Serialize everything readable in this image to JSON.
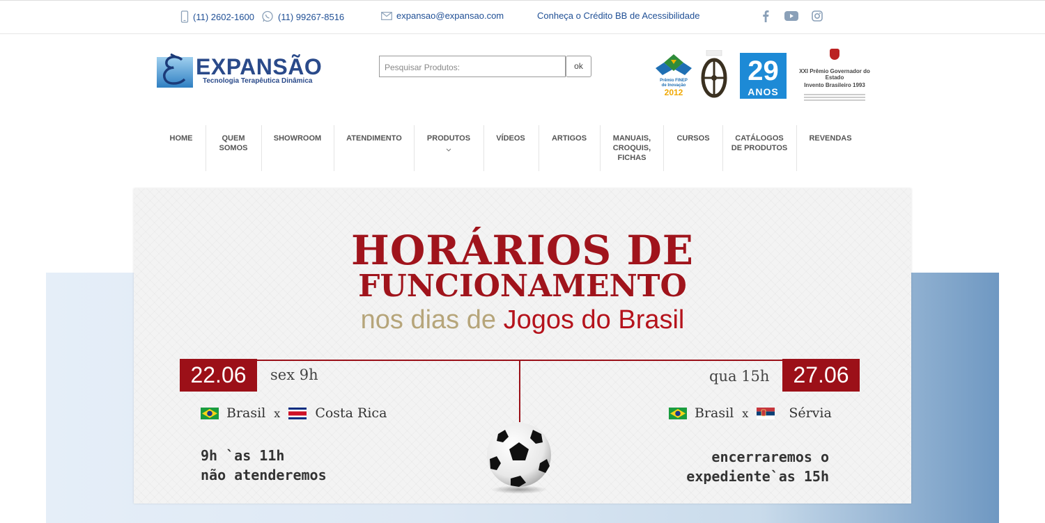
{
  "topbar": {
    "phone": "(11) 2602-1600",
    "whatsapp": "(11) 99267-8516",
    "email": "expansao@expansao.com",
    "accessibility_link": "Conheça o Crédito BB de Acessibilidade",
    "icons": [
      "phone-icon",
      "whatsapp-icon",
      "mail-icon",
      "facebook-icon",
      "youtube-icon",
      "instagram-icon"
    ]
  },
  "header": {
    "brand": "EXPANSÃO",
    "tagline": "Tecnologia Terapêutica Dinâmica",
    "search_placeholder": "Pesquisar Produtos:",
    "search_button": "ok",
    "awards": {
      "finep_line1": "Prêmio FINEP",
      "finep_line2": "de Inovação",
      "finep_year": "2012",
      "years_number": "29",
      "years_label": "ANOS",
      "gov_line1": "XXI Prêmio Governador do Estado",
      "gov_line2": "Invento Brasileiro 1993"
    }
  },
  "nav": {
    "items": [
      {
        "label": "HOME"
      },
      {
        "label": "QUEM\nSOMOS"
      },
      {
        "label": "SHOWROOM"
      },
      {
        "label": "ATENDIMENTO"
      },
      {
        "label": "PRODUTOS",
        "dropdown": true
      },
      {
        "label": "VÍDEOS"
      },
      {
        "label": "ARTIGOS"
      },
      {
        "label": "MANUAIS,\nCROQUIS,\nFICHAS"
      },
      {
        "label": "CURSOS"
      },
      {
        "label": "CATÁLOGOS\nDE PRODUTOS"
      },
      {
        "label": "REVENDAS"
      }
    ]
  },
  "banner": {
    "title_line1": "HORÁRIOS DE",
    "title_line2": "FUNCIONAMENTO",
    "subtitle_a": "nos dias de",
    "subtitle_b": "Jogos do Brasil",
    "game1": {
      "date": "22.06",
      "day_time": "sex 9h",
      "team1": "Brasil",
      "vs": "x",
      "team2": "Costa Rica",
      "note_line1": "9h `as 11h",
      "note_line2": "não atenderemos"
    },
    "game2": {
      "date": "27.06",
      "day_time": "qua 15h",
      "team1": "Brasil",
      "vs": "x",
      "team2": "Sérvia",
      "note_line1": "encerraremos o",
      "note_line2": "expediente`as 15h"
    }
  },
  "colors": {
    "brand_blue": "#2a4a8a",
    "link_blue": "#1f4f95",
    "banner_red": "#9c1018",
    "subtitle_gold": "#b6a57a"
  }
}
